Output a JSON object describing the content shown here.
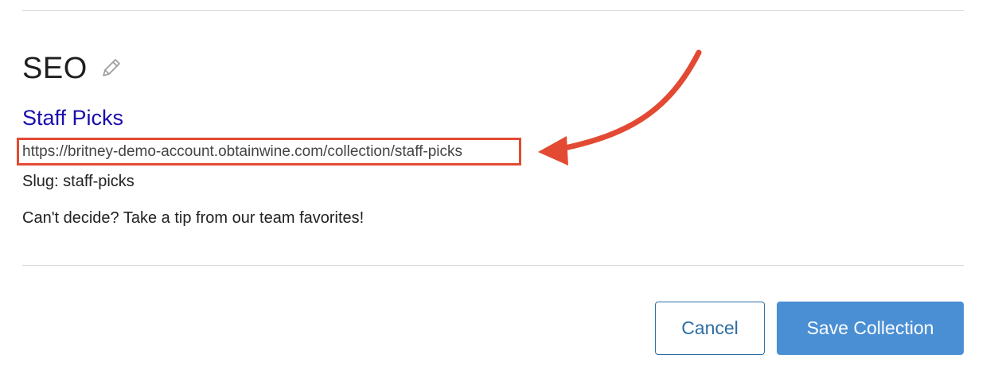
{
  "seo": {
    "heading": "SEO",
    "edit_icon": "pencil-icon"
  },
  "preview": {
    "title": "Staff Picks",
    "url": "https://britney-demo-account.obtainwine.com/collection/staff-picks",
    "slug": "Slug: staff-picks",
    "description": "Can't decide? Take a tip from our team favorites!"
  },
  "annotation": {
    "color": "#e34a33",
    "icon": "arrow-icon"
  },
  "actions": {
    "cancel_label": "Cancel",
    "save_label": "Save Collection"
  },
  "colors": {
    "link_title": "#1a0dab",
    "primary_button": "#4a8fd4",
    "secondary_button_border": "#2e6da4"
  }
}
